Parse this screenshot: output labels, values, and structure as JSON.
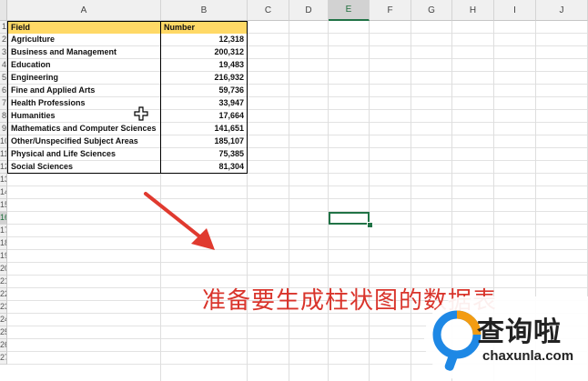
{
  "columns": [
    {
      "letter": "A",
      "id": "A"
    },
    {
      "letter": "B",
      "id": "B"
    },
    {
      "letter": "C",
      "id": "C"
    },
    {
      "letter": "D",
      "id": "D"
    },
    {
      "letter": "E",
      "id": "E"
    },
    {
      "letter": "F",
      "id": "F"
    },
    {
      "letter": "G",
      "id": "G"
    },
    {
      "letter": "H",
      "id": "H"
    },
    {
      "letter": "I",
      "id": "I"
    },
    {
      "letter": "J",
      "id": "J"
    }
  ],
  "row_numbers": [
    "1",
    "2",
    "3",
    "4",
    "5",
    "6",
    "7",
    "8",
    "9",
    "10",
    "11",
    "12",
    "13",
    "14",
    "15",
    "16",
    "17",
    "18",
    "19",
    "20",
    "21",
    "22",
    "23",
    "24",
    "25",
    "26",
    "27"
  ],
  "selected_column": "E",
  "selected_row": "16",
  "table": {
    "header": {
      "field": "Field",
      "number": "Number"
    },
    "rows": [
      {
        "field": "Agriculture",
        "number": "12,318"
      },
      {
        "field": "Business and Management",
        "number": "200,312"
      },
      {
        "field": "Education",
        "number": "19,483"
      },
      {
        "field": "Engineering",
        "number": "216,932"
      },
      {
        "field": "Fine and Applied Arts",
        "number": "59,736"
      },
      {
        "field": "Health Professions",
        "number": "33,947"
      },
      {
        "field": "Humanities",
        "number": "17,664"
      },
      {
        "field": "Mathematics and Computer Sciences",
        "number": "141,651"
      },
      {
        "field": "Other/Unspecified Subject Areas",
        "number": "185,107"
      },
      {
        "field": "Physical and Life Sciences",
        "number": "75,385"
      },
      {
        "field": "Social Sciences",
        "number": "81,304"
      }
    ]
  },
  "annotation": {
    "caption": "准备要生成柱状图的数据表"
  },
  "watermark": {
    "title": "查询啦",
    "subtitle": "chaxunla.com"
  },
  "colors": {
    "header_fill": "#ffd966",
    "selection": "#217346",
    "arrow": "#e03a2f",
    "caption": "#d9342b",
    "watermark_blue": "#1e88e5",
    "watermark_orange": "#f39c12"
  }
}
